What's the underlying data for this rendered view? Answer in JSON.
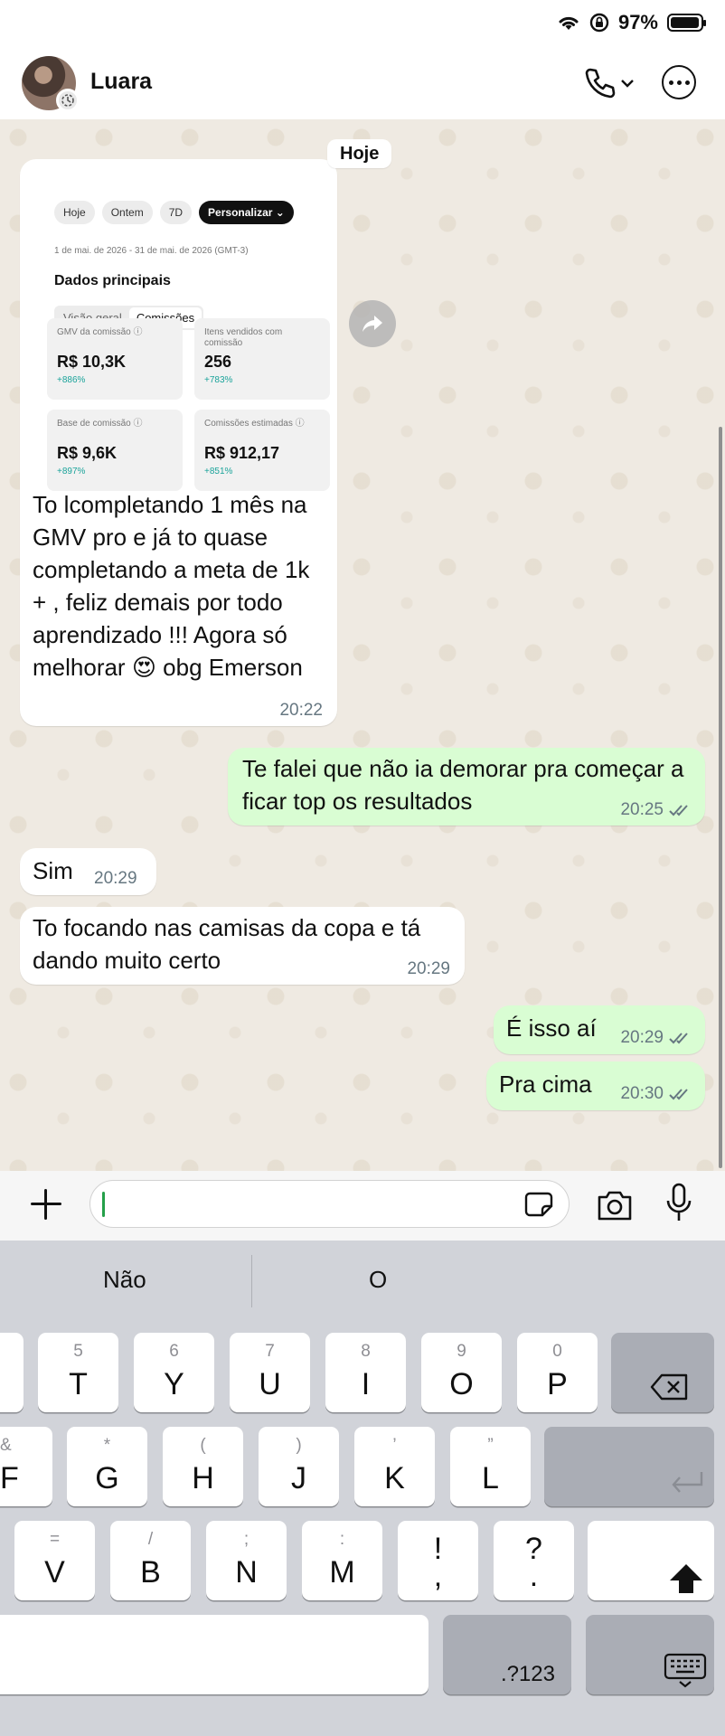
{
  "status_bar": {
    "battery": "97%",
    "battery_level": 0.97
  },
  "header": {
    "contact_name": "Luara"
  },
  "chat": {
    "day_label": "Hoje",
    "image_message": {
      "screenshot": {
        "chips": [
          "Hoje",
          "Ontem",
          "7D",
          "Personalizar ⌄"
        ],
        "date_range": "1 de mai. de 2026 - 31 de mai. de 2026 (GMT-3)",
        "section_title": "Dados principais",
        "tabs": [
          "Visão geral",
          "Comissões"
        ],
        "metrics": [
          {
            "label": "GMV da comissão ⓘ",
            "value": "R$ 10,3K",
            "change": "+886%"
          },
          {
            "label": "Itens vendidos com comissão",
            "value": "256",
            "change": "+783%"
          },
          {
            "label": "Base de comissão ⓘ",
            "value": "R$ 9,6K",
            "change": "+897%"
          },
          {
            "label": "Comissões estimadas ⓘ",
            "value": "R$ 912,17",
            "change": "+851%"
          }
        ]
      },
      "caption": "To lcompletando 1 mês na GMV pro e já to quase completando a meta de 1k + ,  feliz demais por todo aprendizado !!! Agora só melhorar 😍 obg Emerson",
      "time": "20:22"
    },
    "messages": [
      {
        "text": "Te falei que não ia demorar pra começar a ficar top os resultados",
        "time": "20:25",
        "direction": "out"
      },
      {
        "text": "Sim",
        "time": "20:29",
        "direction": "in"
      },
      {
        "text": "To focando nas camisas da copa e tá dando muito certo",
        "time": "20:29",
        "direction": "in"
      },
      {
        "text": "É isso aí",
        "time": "20:29",
        "direction": "out"
      },
      {
        "text": "Pra cima",
        "time": "20:30",
        "direction": "out"
      }
    ]
  },
  "composer": {
    "input_value": ""
  },
  "keyboard": {
    "suggestions": [
      "Não",
      "O"
    ],
    "rows": [
      [
        {
          "alt": "5",
          "key": "T"
        },
        {
          "alt": "6",
          "key": "Y"
        },
        {
          "alt": "7",
          "key": "U"
        },
        {
          "alt": "8",
          "key": "I"
        },
        {
          "alt": "9",
          "key": "O"
        },
        {
          "alt": "0",
          "key": "P"
        }
      ],
      [
        {
          "alt": "&",
          "key": "F"
        },
        {
          "alt": "*",
          "key": "G"
        },
        {
          "alt": "(",
          "key": "H"
        },
        {
          "alt": ")",
          "key": "J"
        },
        {
          "alt": "’",
          "key": "K"
        },
        {
          "alt": "”",
          "key": "L"
        }
      ],
      [
        {
          "alt": "=",
          "key": "V"
        },
        {
          "alt": "/",
          "key": "B"
        },
        {
          "alt": ";",
          "key": "N"
        },
        {
          "alt": ":",
          "key": "M"
        },
        {
          "alt": "!",
          "key": ","
        },
        {
          "alt": "?",
          "key": "."
        }
      ]
    ],
    "numbers_key": ".?123"
  },
  "colors": {
    "chat_bg": "#efeae2",
    "outgoing_bubble": "#d9fdd3",
    "incoming_bubble": "#ffffff",
    "tick_color": "#667781",
    "metric_change": "#1aa39a"
  }
}
